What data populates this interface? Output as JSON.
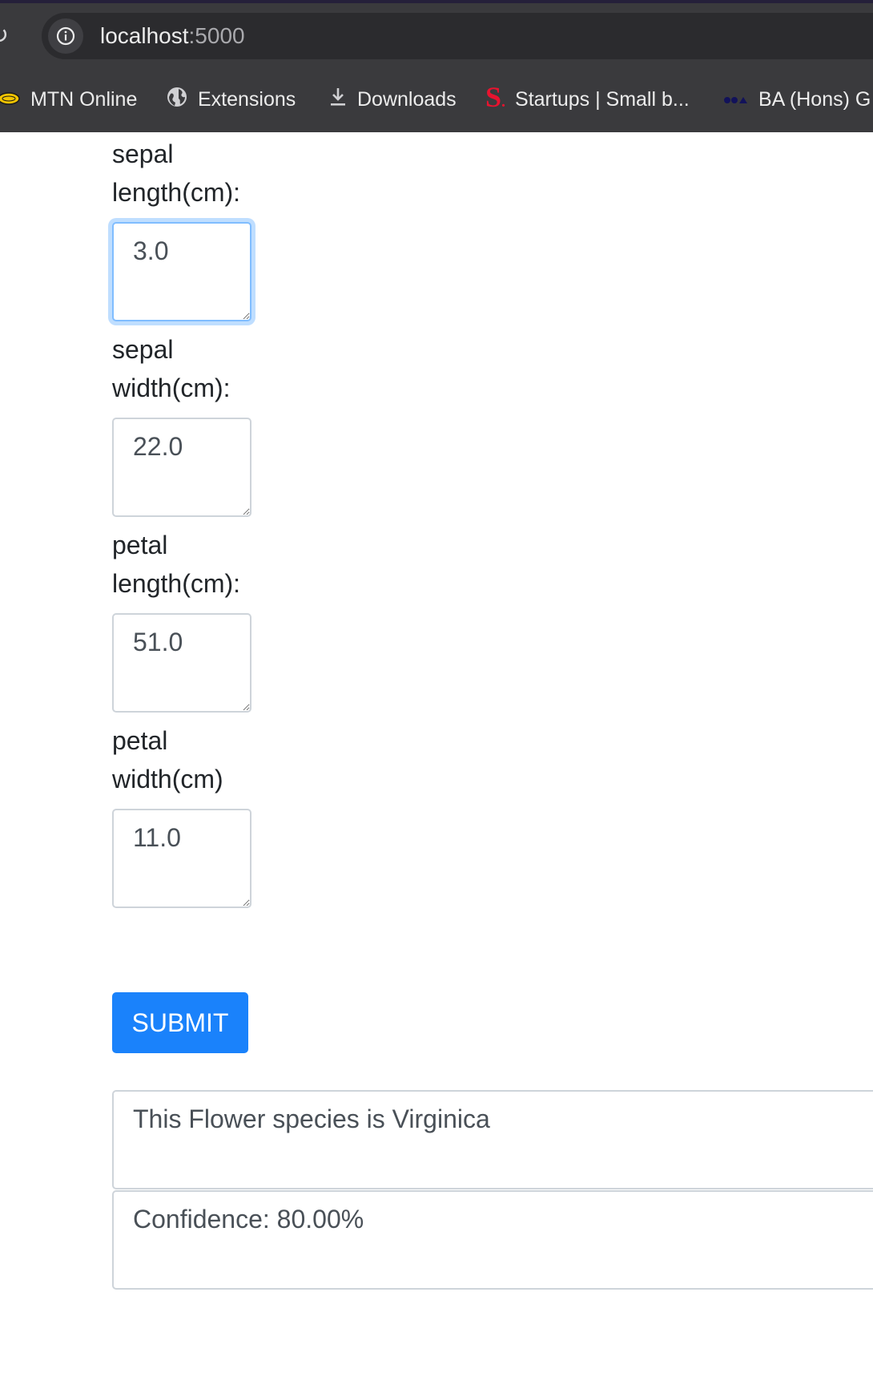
{
  "browser": {
    "url_host": "localhost",
    "url_port": ":5000",
    "bookmarks": [
      {
        "label": "MTN Online",
        "icon": "mtn-logo-icon"
      },
      {
        "label": "Extensions",
        "icon": "globe-icon"
      },
      {
        "label": "Downloads",
        "icon": "download-icon"
      },
      {
        "label": "Startups | Small b...",
        "icon": "startups-s-logo-icon"
      },
      {
        "label": "BA (Hons) G",
        "icon": "oca-logo-icon"
      }
    ]
  },
  "form": {
    "fields": [
      {
        "label": "sepal length(cm):",
        "value": "3.0",
        "focused": true
      },
      {
        "label": "sepal width(cm):",
        "value": "22.0",
        "focused": false
      },
      {
        "label": "petal length(cm):",
        "value": "51.0",
        "focused": false
      },
      {
        "label": "petal width(cm)",
        "value": "11.0",
        "focused": false
      }
    ],
    "submit_label": "SUBMIT"
  },
  "results": {
    "prediction": "This Flower species is Virginica",
    "confidence": "Confidence: 80.00%"
  },
  "colors": {
    "chrome_bg": "#3a3a3d",
    "omnibox_bg": "#2b2b2e",
    "submit_bg": "#1a82fb",
    "focus_border": "#80bdff",
    "text": "#212529"
  }
}
